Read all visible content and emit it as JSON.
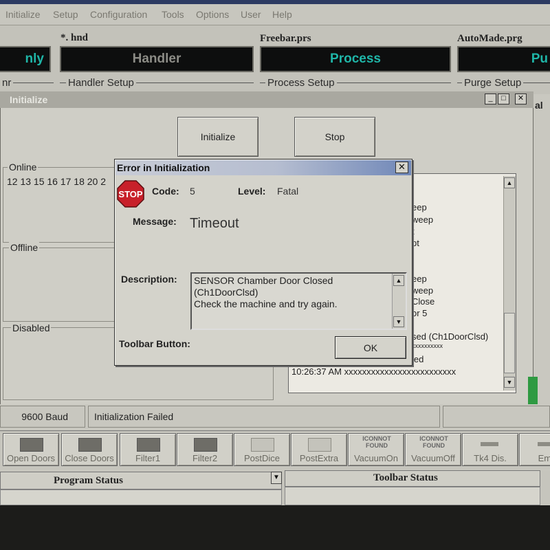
{
  "menu": [
    "Initialize",
    "Setup",
    "Configuration",
    "Tools",
    "Options",
    "User",
    "Help"
  ],
  "top_panels": {
    "hnd_file": "*. hnd",
    "prs_file": "Freebar.prs",
    "prg_file": "AutoMade.prg",
    "panel1_text": "nly",
    "panel2_text": "Handler",
    "panel3_text": "Process",
    "panel4_text": "Pu",
    "group0_label": "nr",
    "group1_label": "Handler Setup",
    "group2_label": "Process Setup",
    "group3_label": "Purge Setup",
    "edge_text": "al"
  },
  "initialize_window": {
    "title": "Initialize",
    "minimize": "_",
    "maximize": "□",
    "close": "✕",
    "initialize_button": "Initialize",
    "stop_button": "Stop",
    "online_label": "Online",
    "online_numbers": "12 13 15 16 17 18 20 2",
    "offline_label": "Offline",
    "disabled_label": "Disabled"
  },
  "log": {
    "lines": [
      "eep",
      "weep",
      "t",
      "pt",
      "eep",
      "weep",
      "Close",
      "or 5",
      "sed (Ch1DoorClsd)",
      "xxxxxxxxxx",
      "led",
      "10:26:37 AM  xxxxxxxxxxxxxxxxxxxxxxxxx"
    ]
  },
  "status": {
    "baud": "9600 Baud",
    "message": "Initialization Failed"
  },
  "toolbar": {
    "buttons": [
      {
        "label": "Open Doors",
        "icon": "dark-square-icon"
      },
      {
        "label": "Close Doors",
        "icon": "dark-square-icon"
      },
      {
        "label": "Filter1",
        "icon": "dark-square-icon"
      },
      {
        "label": "Filter2",
        "icon": "dark-square-icon"
      },
      {
        "label": "PostDice",
        "icon": "grid-icon"
      },
      {
        "label": "PostExtra",
        "icon": "grid-icon"
      },
      {
        "label": "VacuumOn",
        "icon": "no-icon",
        "icon_text": "ICONNOT FOUND"
      },
      {
        "label": "VacuumOff",
        "icon": "no-icon",
        "icon_text": "ICONNOT FOUND"
      },
      {
        "label": "Tk4 Dis.",
        "icon": "arrow-icon"
      },
      {
        "label": "Emp",
        "icon": "arrow-icon"
      }
    ]
  },
  "bottom": {
    "program_status": "Program Status",
    "toolbar_status": "Toolbar Status"
  },
  "dialog": {
    "title": "Error in Initialization",
    "close": "✕",
    "stop_text": "STOP",
    "code_label": "Code:",
    "code_value": "5",
    "level_label": "Level:",
    "level_value": "Fatal",
    "message_label": "Message:",
    "message_value": "Timeout",
    "description_label": "Description:",
    "description_lines": [
      "SENSOR Chamber Door Closed",
      "(Ch1DoorClsd)",
      "Check the machine and try again."
    ],
    "toolbar_button_label": "Toolbar Button:",
    "ok_button": "OK"
  },
  "colors": {
    "panel_text_dim": "#8c8c86",
    "panel_text_cyan": "#1fb6a8",
    "dialog_title_gradient_end": "#6f87b8",
    "stop_red": "#c8202a",
    "green_indicator": "#2f9a42"
  }
}
